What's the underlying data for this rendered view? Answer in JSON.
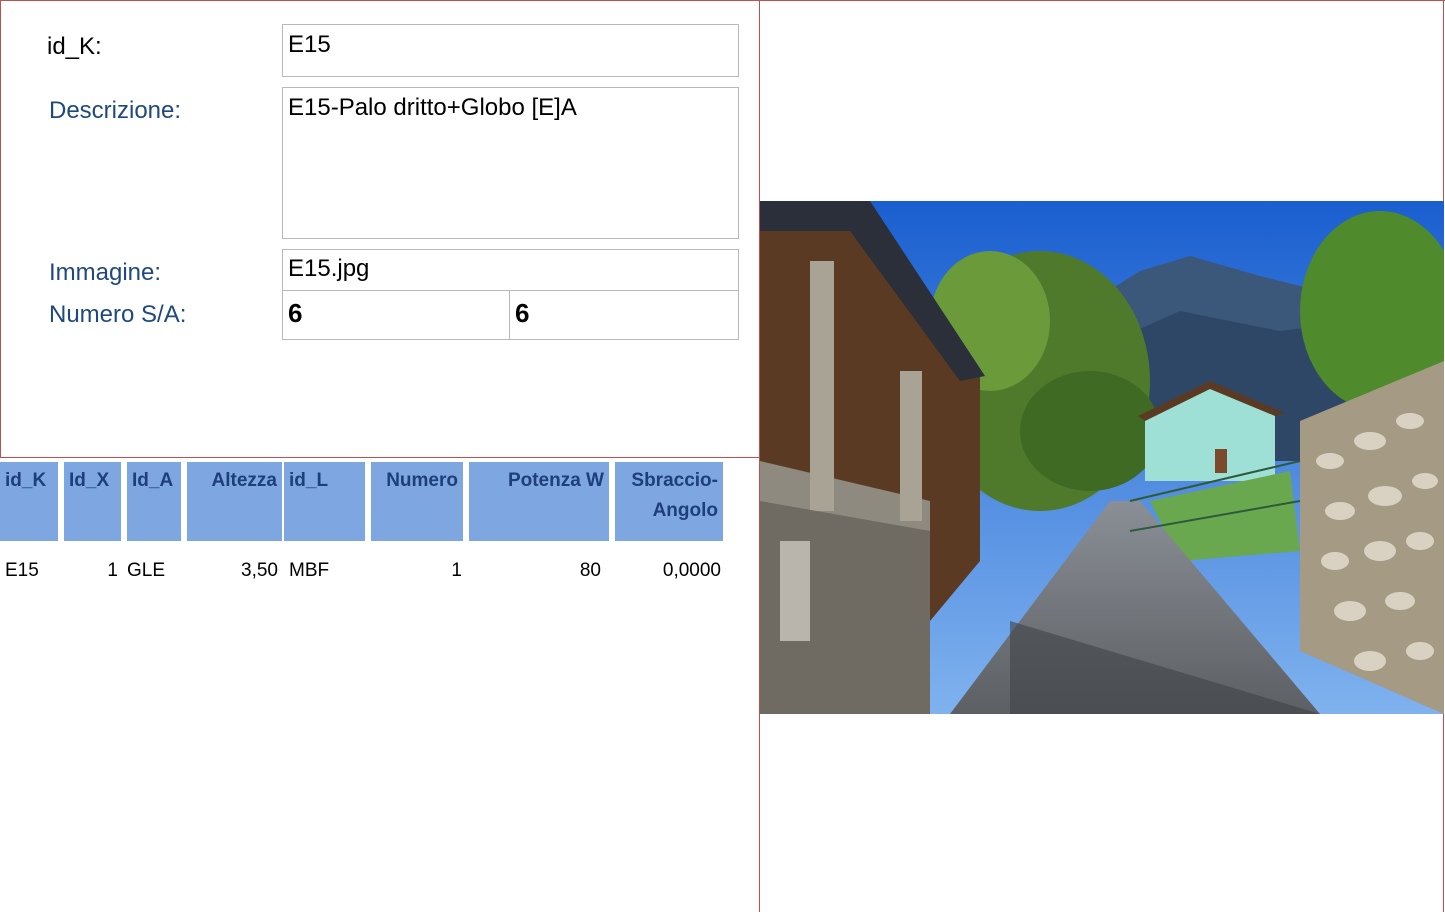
{
  "form": {
    "id_k": {
      "label": "id_K:",
      "value": "E15"
    },
    "descrizione": {
      "label": "Descrizione:",
      "value": "E15-Palo dritto+Globo [E]A"
    },
    "immagine": {
      "label": "Immagine:",
      "value": "E15.jpg"
    },
    "numero_sa": {
      "label": "Numero S/A:",
      "value_s": "6",
      "value_a": "6"
    }
  },
  "table": {
    "headers": [
      "id_K",
      "Id_X",
      "Id_A",
      "Altezza",
      "id_L",
      "Numero",
      "Potenza W",
      "Sbraccio-Angolo"
    ],
    "rows": [
      [
        "E15",
        "1",
        "GLE",
        "3,50",
        "MBF",
        "1",
        "80",
        "0,0000"
      ]
    ]
  },
  "photo": {
    "icon": "street-scene-photo",
    "colors": {
      "sky": "#1f66d6",
      "mountain": "#3b587a",
      "wall": "#a8a090",
      "grass": "#6aa84f"
    }
  },
  "colors": {
    "label_blue": "#1f497d",
    "header_bg": "#7ea6e0",
    "header_text": "#1f3f7a",
    "border_red": "#c0504d"
  }
}
